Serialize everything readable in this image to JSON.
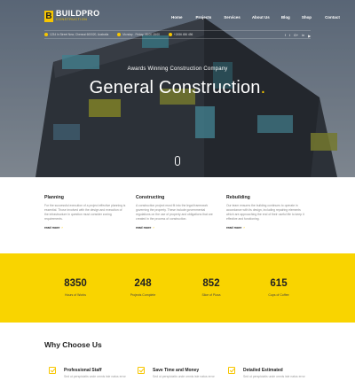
{
  "brand": {
    "name": "BUILDPRO",
    "tagline": "CONSTRUCTION",
    "mark": "B"
  },
  "nav": [
    "Home",
    "Projects",
    "Services",
    "About Us",
    "Blog",
    "Shop",
    "Contact"
  ],
  "info": {
    "address": "1234 In Street New, Chennai 600020, Australia",
    "hours": "Monday - Friday: 08:00 18:00",
    "phone": "+2456 456 456"
  },
  "social": [
    "f",
    "t",
    "G+",
    "in",
    "▶"
  ],
  "hero": {
    "subtitle": "Awards Winning Construction Company",
    "title": "General Construction",
    "title_dot": "."
  },
  "features": [
    {
      "title": "Planning",
      "text": "For the successful execution of a project effective planning is essential. Those involved with the design and execution of the infrastructure in question must consider zoning requirements.",
      "link": "read more"
    },
    {
      "title": "Constructing",
      "text": "A construction project must fit into the legal framework governing the property. These include governmental regulations on the use of property and obligations that are created in the process of construction.",
      "link": "read more"
    },
    {
      "title": "Rebuilding",
      "text": "Our team ensures the building continues to operate in accordance with its design, including repairing elements which are approaching the end of their useful life to keep it effective and functioning.",
      "link": "read more"
    }
  ],
  "stats": [
    {
      "value": "8350",
      "label": "Hours of Works"
    },
    {
      "value": "248",
      "label": "Projects Complete"
    },
    {
      "value": "852",
      "label": "Slice of Pizza"
    },
    {
      "value": "615",
      "label": "Cups of Coffee"
    }
  ],
  "why": {
    "title": "Why Choose Us",
    "items": [
      {
        "name": "Professional Staff",
        "text": "Sed ut perspiciatis unde omnis iste natus error"
      },
      {
        "name": "Save Time and Money",
        "text": "Sed ut perspiciatis unde omnis iste natus error"
      },
      {
        "name": "Detailed Estimated",
        "text": "Sed ut perspiciatis unde omnis iste natus error"
      }
    ]
  },
  "colors": {
    "accent": "#f7c600",
    "stats_bg": "#f9d400"
  }
}
